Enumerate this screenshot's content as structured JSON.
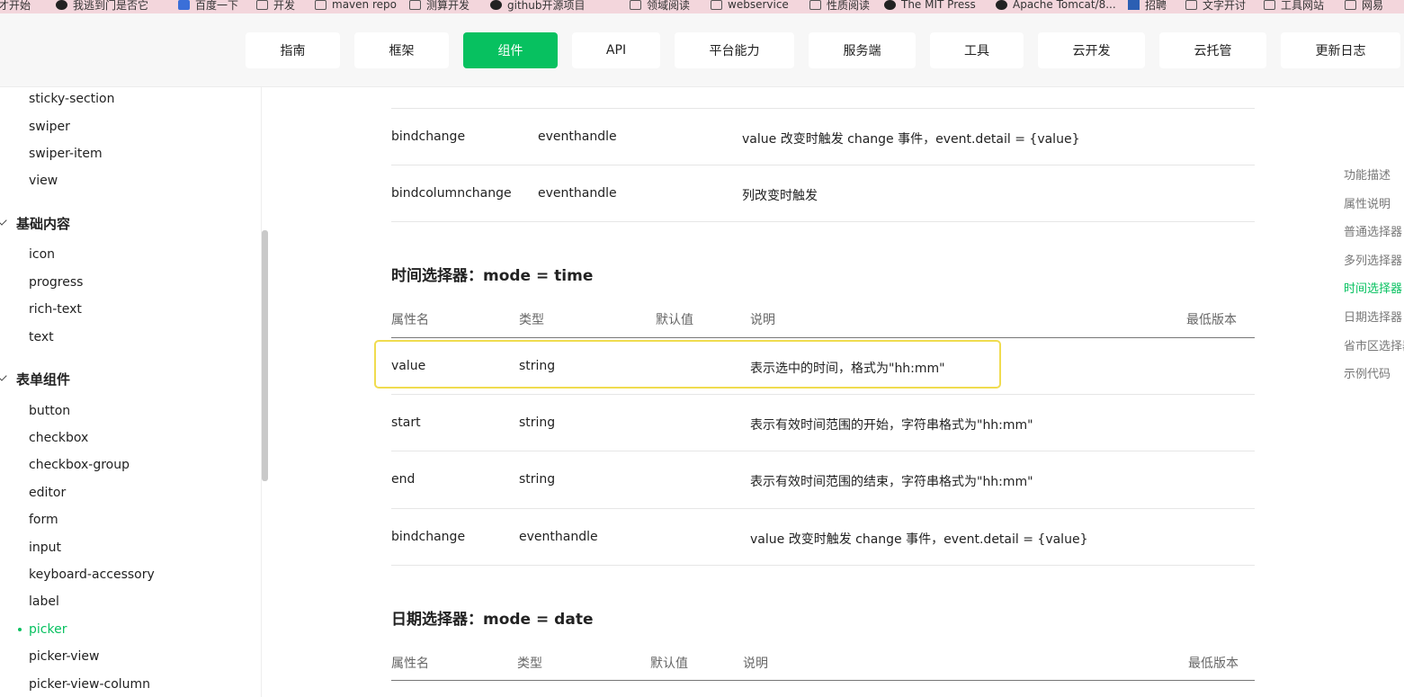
{
  "bookmarks": [
    "才开始",
    "我逃到门是否它",
    "百度一下",
    "开发",
    "maven repo",
    "测算开发",
    "github开源项目",
    "领域阅读",
    "webservice",
    "性质阅读",
    "The MIT Press",
    "Apache Tomcat/8...",
    "招聘",
    "文字开讨",
    "工具网站",
    "网易"
  ],
  "topnav": {
    "items": [
      "指南",
      "框架",
      "组件",
      "API",
      "平台能力",
      "服务端",
      "工具",
      "云开发",
      "云托管",
      "更新日志"
    ],
    "active": "组件"
  },
  "sidebar": {
    "items_top": [
      "sticky-section",
      "swiper",
      "swiper-item",
      "view"
    ],
    "group_basic": "基础内容",
    "items_basic": [
      "icon",
      "progress",
      "rich-text",
      "text"
    ],
    "group_form": "表单组件",
    "items_form": [
      "button",
      "checkbox",
      "checkbox-group",
      "editor",
      "form",
      "input",
      "keyboard-accessory",
      "label",
      "picker",
      "picker-view",
      "picker-view-column"
    ],
    "active_item": "picker"
  },
  "prev_table": {
    "rows": [
      {
        "name": "bindchange",
        "type": "eventhandle",
        "desc": "value 改变时触发 change 事件，event.detail = {value}"
      },
      {
        "name": "bindcolumnchange",
        "type": "eventhandle",
        "desc": "列改变时触发"
      }
    ]
  },
  "time_section": {
    "title": "时间选择器：mode = time",
    "headers": {
      "name": "属性名",
      "type": "类型",
      "default": "默认值",
      "desc": "说明",
      "version": "最低版本"
    },
    "rows": [
      {
        "name": "value",
        "type": "string",
        "desc": "表示选中的时间，格式为\"hh:mm\""
      },
      {
        "name": "start",
        "type": "string",
        "desc": "表示有效时间范围的开始，字符串格式为\"hh:mm\""
      },
      {
        "name": "end",
        "type": "string",
        "desc": "表示有效时间范围的结束，字符串格式为\"hh:mm\""
      },
      {
        "name": "bindchange",
        "type": "eventhandle",
        "desc": "value 改变时触发 change 事件，event.detail = {value}"
      }
    ]
  },
  "date_section": {
    "title": "日期选择器：mode = date",
    "headers": {
      "name": "属性名",
      "type": "类型",
      "default": "默认值",
      "desc": "说明",
      "version": "最低版本"
    }
  },
  "toc": {
    "items": [
      "功能描述",
      "属性说明",
      "普通选择器",
      "多列选择器",
      "时间选择器",
      "日期选择器",
      "省市区选择器",
      "示例代码"
    ],
    "active": "时间选择器"
  }
}
